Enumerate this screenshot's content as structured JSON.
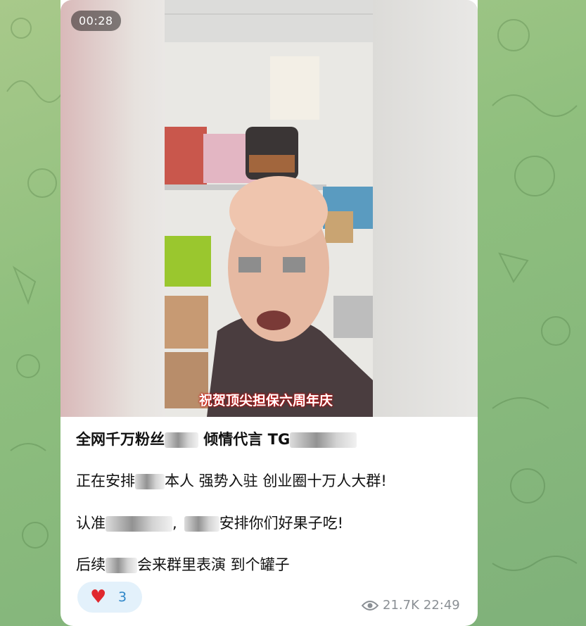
{
  "video": {
    "duration": "00:28",
    "caption": "祝贺顶尖担保六周年庆"
  },
  "message": {
    "line1_a": "全网千万粉丝",
    "line1_b": "倾情代言 TG",
    "line2_a": "正在安排",
    "line2_b": "本人 强势入驻 创业圈十万人大群!",
    "line3_a": "认准",
    "line3_b": "安排你们好果子吃!",
    "line4_a": "后续",
    "line4_b": "会来群里表演 到个罐子"
  },
  "reactions": {
    "emoji": "heart-icon",
    "count": "3"
  },
  "footer": {
    "views": "21.7K",
    "time": "22:49"
  },
  "colors": {
    "background": "#8fbf7e",
    "reaction_bg": "#e3f1fb",
    "reaction_text": "#2d86c8",
    "heart": "#e0282e"
  }
}
